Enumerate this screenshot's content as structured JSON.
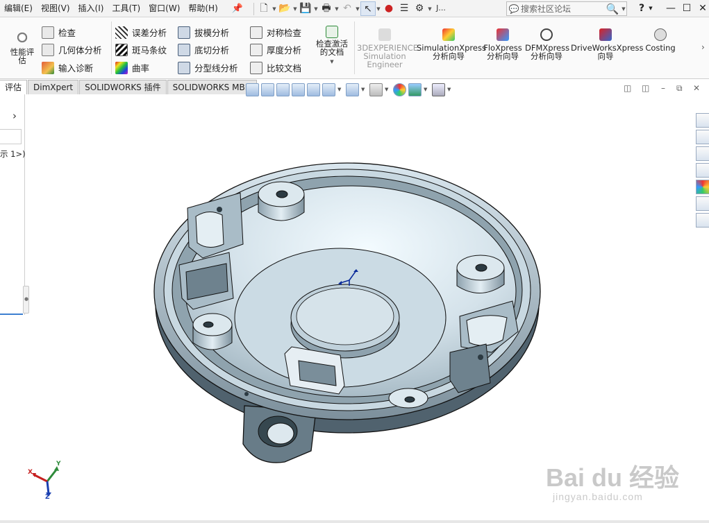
{
  "menubar": {
    "items": [
      "编辑(E)",
      "视图(V)",
      "插入(I)",
      "工具(T)",
      "窗口(W)",
      "帮助(H)"
    ],
    "user_initial": "J...",
    "search_placeholder": "搜索社区论坛",
    "help_label": "?"
  },
  "ribbon": {
    "perf_eval": "性能评估",
    "check": "检查",
    "geometry_analysis": "几何体分析",
    "import_diag": "输入诊断",
    "deviation_analysis": "误差分析",
    "zebra_stripes": "斑马条纹",
    "curvature": "曲率",
    "draft_analysis": "拔模分析",
    "undercut_analysis": "底切分析",
    "parting_line_analysis": "分型线分析",
    "symmetry_check": "对称检查",
    "thickness_analysis": "厚度分析",
    "compare_docs": "比较文档",
    "check_active_doc": "检查激活的文档",
    "simulation_engineer": "3DEXPERIENCE Simulation Engineer",
    "simulationxpress": "SimulationXpress 分析向导",
    "floxpress": "FloXpress 分析向导",
    "dfmxpress": "DFMXpress 分析向导",
    "driveworksxpress": "DriveWorksXpress 向导",
    "costing": "Costing"
  },
  "tabs": [
    "评估",
    "DimXpert",
    "SOLIDWORKS 插件",
    "SOLIDWORKS MBD"
  ],
  "left_panel": {
    "tree_text": "示 1>)"
  },
  "triad": {
    "x": "X",
    "y": "Y",
    "z": "Z"
  },
  "watermark": {
    "logo_text": "Bai du 经验",
    "url": "jingyan.baidu.com"
  },
  "colors": {
    "model_body": "#c3d3dc",
    "model_shadow": "#607480",
    "accent_blue": "#2a6bd1",
    "ribbon_bg": "#fafafa"
  }
}
